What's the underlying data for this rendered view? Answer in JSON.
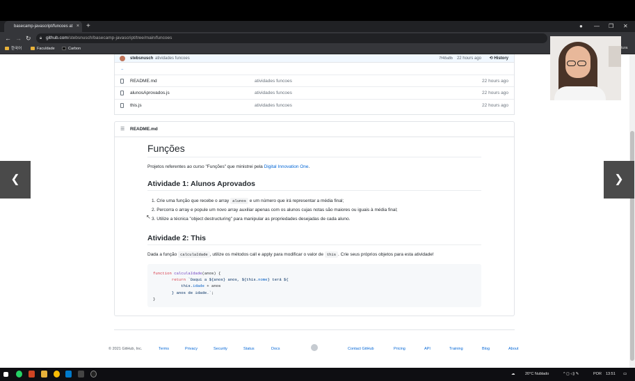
{
  "browser": {
    "tab_title": "basecamp-javascript/funcoes at",
    "tab_close": "×",
    "new_tab": "+",
    "url_host": "github.com",
    "url_path": "/stebsnusch/basecamp-javascript/tree/main/funcoes",
    "bookmarks": [
      "한국어",
      "Faculdade",
      "Carbon"
    ],
    "side_label": "tura"
  },
  "commit": {
    "author": "stebsnusch",
    "message": "atividades funcoes",
    "sha": "7f48a8b",
    "time": "22 hours ago",
    "history": "History"
  },
  "files": [
    {
      "name": "..",
      "message": "",
      "time": ""
    },
    {
      "name": "README.md",
      "message": "atividades funcoes",
      "time": "22 hours ago"
    },
    {
      "name": "alunosAprovados.js",
      "message": "atividades funcoes",
      "time": "22 hours ago"
    },
    {
      "name": "this.js",
      "message": "atividades funcoes",
      "time": "22 hours ago"
    }
  ],
  "readme": {
    "header": "README.md",
    "title": "Funções",
    "intro_prefix": "Projetos referentes ao curso \"Funções\" que ministrei pela ",
    "intro_link": "Digital Innovation One",
    "intro_suffix": ".",
    "h2_1": "Atividade 1: Alunos Aprovados",
    "item1_prefix": "1. Crie uma função que recebe o array ",
    "item1_code": "alunos",
    "item1_suffix": " e um número que irá representar a média final;",
    "item2": "2. Percorra o array e popule um novo array auxiliar apenas com os alunos cujas notas são maiores ou iguais à média final;",
    "item3": "3. Utilize a técnica \"object destructuring\" para manipular as propriedades desejadas de cada aluno.",
    "h2_2": "Atividade 2: This",
    "p2_prefix": "Dada a função ",
    "p2_code1": "calculaIdade",
    "p2_mid": ", utilize os métodos call e apply para modificar o valor de ",
    "p2_code2": "this",
    "p2_suffix": ". Crie seus próprios objetos para esta atividade!",
    "code": {
      "l1_kw": "function",
      "l1_fn": "calculaIdade",
      "l1_rest": "(anos) {",
      "l2_kw": "return",
      "l2_str1": "`Daqui a ${anos} anos, ${this.",
      "l2_prop1": "nome",
      "l2_str2": "} terá ${",
      "l3_str1": "this.",
      "l3_prop": "idade",
      "l3_rest": " + anos",
      "l4_str": "} anos de idade.`",
      "l4_rest": ";",
      "l5": "}"
    }
  },
  "footer": {
    "copyright": "© 2021 GitHub, Inc.",
    "links_left": [
      "Terms",
      "Privacy",
      "Security",
      "Status",
      "Docs"
    ],
    "links_right": [
      "Contact GitHub",
      "Pricing",
      "API",
      "Training",
      "Blog",
      "About"
    ]
  },
  "taskbar": {
    "weather": "20°C  Nublado",
    "lang": "POR",
    "time": "13:51"
  },
  "colors": {
    "link": "#0366d6",
    "taskbar": "#0e0e12",
    "chrome": "#35363a"
  }
}
